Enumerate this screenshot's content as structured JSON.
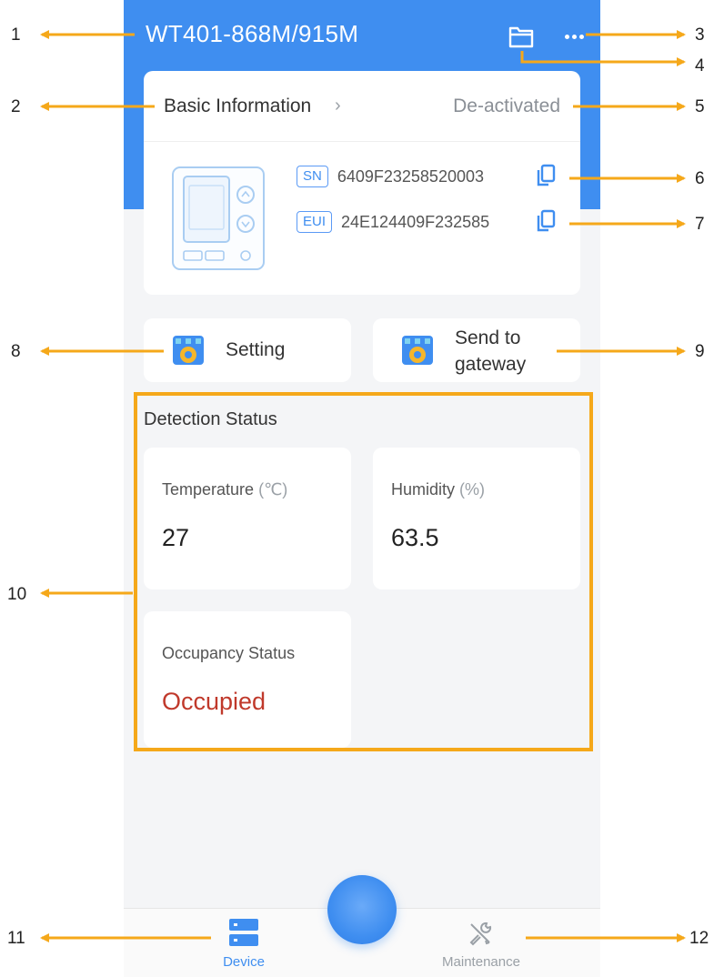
{
  "header": {
    "title": "WT401-868M/915M",
    "folder_icon": "folder-icon",
    "more_icon": "more-icon"
  },
  "basic_info": {
    "title": "Basic Information",
    "chevron": "›",
    "status": "De-activated",
    "sn_tag": "SN",
    "sn_value": "6409F23258520003",
    "eui_tag": "EUI",
    "eui_value": "24E124409F232585"
  },
  "actions": {
    "setting_label": "Setting",
    "send_line1": "Send to",
    "send_line2": "gateway"
  },
  "detection": {
    "title": "Detection Status",
    "temperature_label": "Temperature",
    "temperature_unit": "(℃)",
    "temperature_value": "27",
    "humidity_label": "Humidity",
    "humidity_unit": "(%)",
    "humidity_value": "63.5",
    "occupancy_label": "Occupancy Status",
    "occupancy_value": "Occupied"
  },
  "tabbar": {
    "device_label": "Device",
    "maintenance_label": "Maintenance"
  },
  "annotations": {
    "n1": "1",
    "n2": "2",
    "n3": "3",
    "n4": "4",
    "n5": "5",
    "n6": "6",
    "n7": "7",
    "n8": "8",
    "n9": "9",
    "n10": "10",
    "n11": "11",
    "n12": "12"
  },
  "colors": {
    "accent": "#3f8ef0",
    "highlight": "#f5a81a",
    "occupied": "#c0392b"
  }
}
